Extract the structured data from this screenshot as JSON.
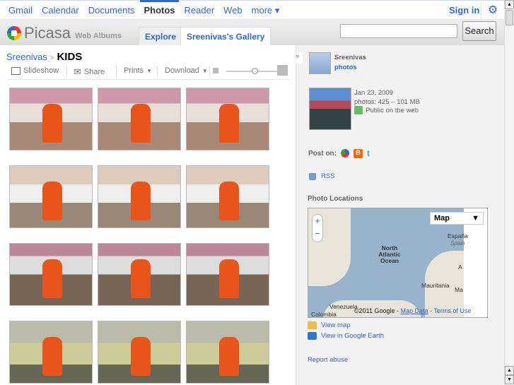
{
  "topnav": {
    "items": [
      "Gmail",
      "Calendar",
      "Documents",
      "Photos",
      "Reader",
      "Web",
      "more ▾"
    ],
    "active": "Photos",
    "signin": "Sign in"
  },
  "header": {
    "logo": "Picasa",
    "logo_sub": "Web Albums",
    "tabs": [
      "Explore",
      "Sreenivas's Gallery"
    ],
    "search_value": "",
    "search_button": "Search"
  },
  "album": {
    "owner": "Sreenivas",
    "sep": ">",
    "title": "KIDS"
  },
  "toolbar": {
    "slideshow": "Slideshow",
    "share": "Share",
    "prints": "Prints",
    "download": "Download"
  },
  "photos": 12,
  "sidebar": {
    "user": "Sreenivas",
    "user_link": "photos",
    "date": "Jan 23, 2009",
    "stats": "photos: 425 – 101 MB",
    "visibility": "Public on the web",
    "post_on": "Post on:",
    "rss": "RSS",
    "locations_title": "Photo Locations",
    "map": {
      "type": "Map",
      "labels": [
        "North Atlantic Ocean",
        "Mauritania",
        "Venezuela",
        "Colombia",
        "España",
        "Spain",
        "A",
        "Ma"
      ],
      "copyright": "©2011 Google -",
      "map_data": "Map Data",
      "terms": "- Terms of Use"
    },
    "view_map": "View map",
    "view_earth": "View in Google Earth",
    "report": "Report abuse"
  }
}
